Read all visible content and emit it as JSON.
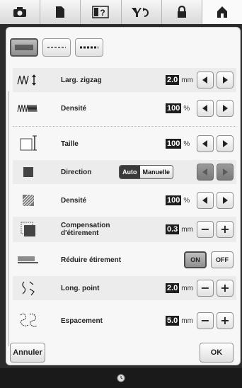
{
  "tabs": [
    {
      "name": "camera-icon"
    },
    {
      "name": "page-icon"
    },
    {
      "name": "help-icon",
      "text": "?"
    },
    {
      "name": "thread-icon"
    },
    {
      "name": "lock-icon"
    },
    {
      "name": "home-icon"
    }
  ],
  "rows": {
    "zigzag": {
      "label": "Larg. zigzag",
      "value": "2.0",
      "unit": "mm"
    },
    "density1": {
      "label": "Densité",
      "value": "100",
      "unit": "%"
    },
    "size": {
      "label": "Taille",
      "value": "100",
      "unit": "%"
    },
    "direction": {
      "label": "Direction",
      "auto": "Auto",
      "manual": "Manuelle"
    },
    "density2": {
      "label": "Densité",
      "value": "100",
      "unit": "%"
    },
    "compensation": {
      "label_line1": "Compensation",
      "label_line2": "d'étirement",
      "value": "0.3",
      "unit": "mm"
    },
    "reduce": {
      "label": "Réduire étirement",
      "on": "ON",
      "off": "OFF"
    },
    "stitch": {
      "label": "Long. point",
      "value": "2.0",
      "unit": "mm"
    },
    "spacing": {
      "label": "Espacement",
      "value": "5.0",
      "unit": "mm"
    }
  },
  "buttons": {
    "cancel": "Annuler",
    "ok": "OK"
  }
}
